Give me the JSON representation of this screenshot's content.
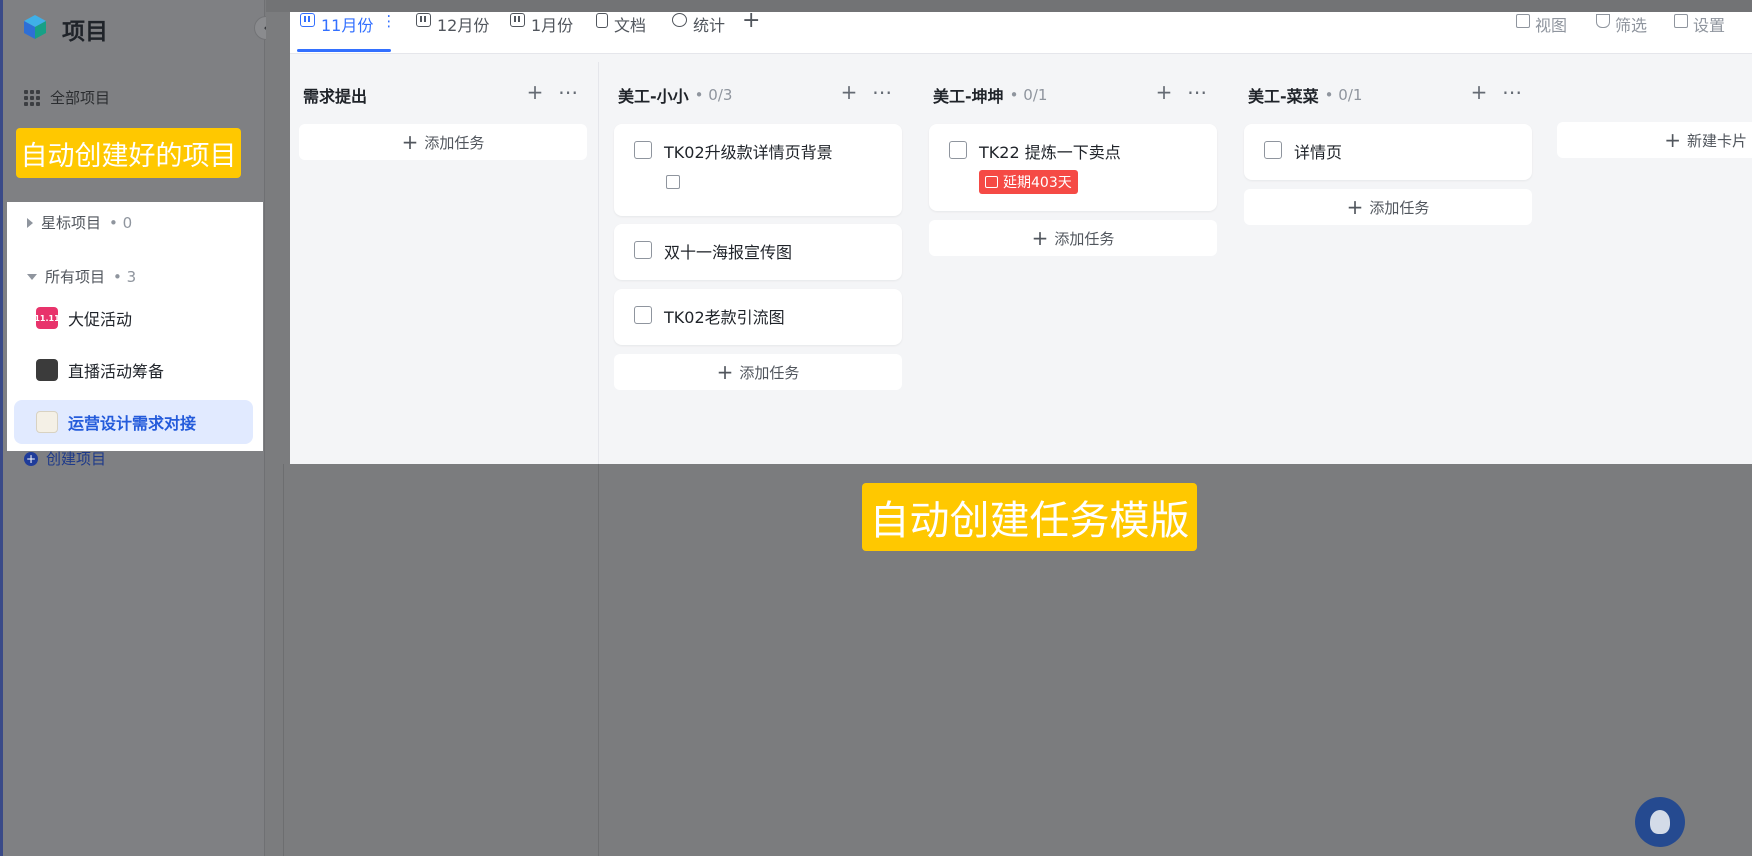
{
  "app": {
    "title": "项目"
  },
  "sidebar": {
    "all_projects": "全部项目",
    "starred": {
      "label": "星标项目",
      "count": "• 0"
    },
    "all": {
      "label": "所有项目",
      "count": "• 3"
    },
    "projects": [
      {
        "name": "大促活动",
        "thumb": "11.11",
        "color": "#e8336b",
        "active": false
      },
      {
        "name": "直播活动筹备",
        "thumb": "",
        "color": "#3b3b3b",
        "active": false
      },
      {
        "name": "运营设计需求对接",
        "thumb": "",
        "color": "#f4f0e6",
        "active": true
      }
    ],
    "create": "创建项目"
  },
  "annotations": {
    "projects_callout": "自动创建好的项目",
    "tasks_callout": "自动创建任务模版"
  },
  "tabs": [
    {
      "label": "11月份",
      "icon": "board-icon",
      "active": true
    },
    {
      "label": "12月份",
      "icon": "board-icon",
      "active": false
    },
    {
      "label": "1月份",
      "icon": "board-icon",
      "active": false
    },
    {
      "label": "文档",
      "icon": "doc-icon",
      "active": false
    },
    {
      "label": "统计",
      "icon": "stat-icon",
      "active": false
    }
  ],
  "toolbar": {
    "view": "视图",
    "filter": "筛选",
    "settings": "设置"
  },
  "columns": [
    {
      "name": "需求提出",
      "count": "",
      "tasks": [],
      "add_label": "添加任务"
    },
    {
      "name": "美工-小小",
      "count": "• 0/3",
      "tasks": [
        {
          "title": "TK02升级款详情页背景",
          "has_edit": true,
          "overdue": ""
        },
        {
          "title": "双十一海报宣传图",
          "has_edit": false,
          "overdue": ""
        },
        {
          "title": "TK02老款引流图",
          "has_edit": false,
          "overdue": ""
        }
      ],
      "add_label": "添加任务"
    },
    {
      "name": "美工-坤坤",
      "count": "• 0/1",
      "tasks": [
        {
          "title": "TK22 提炼一下卖点",
          "has_edit": false,
          "overdue": "延期403天"
        }
      ],
      "add_label": "添加任务"
    },
    {
      "name": "美工-菜菜",
      "count": "• 0/1",
      "tasks": [
        {
          "title": "详情页",
          "has_edit": false,
          "overdue": ""
        }
      ],
      "add_label": "添加任务"
    }
  ],
  "new_card": "新建卡片",
  "colors": {
    "accent": "#3370ff",
    "callout": "#ffc800",
    "overdue": "#f54a45"
  }
}
